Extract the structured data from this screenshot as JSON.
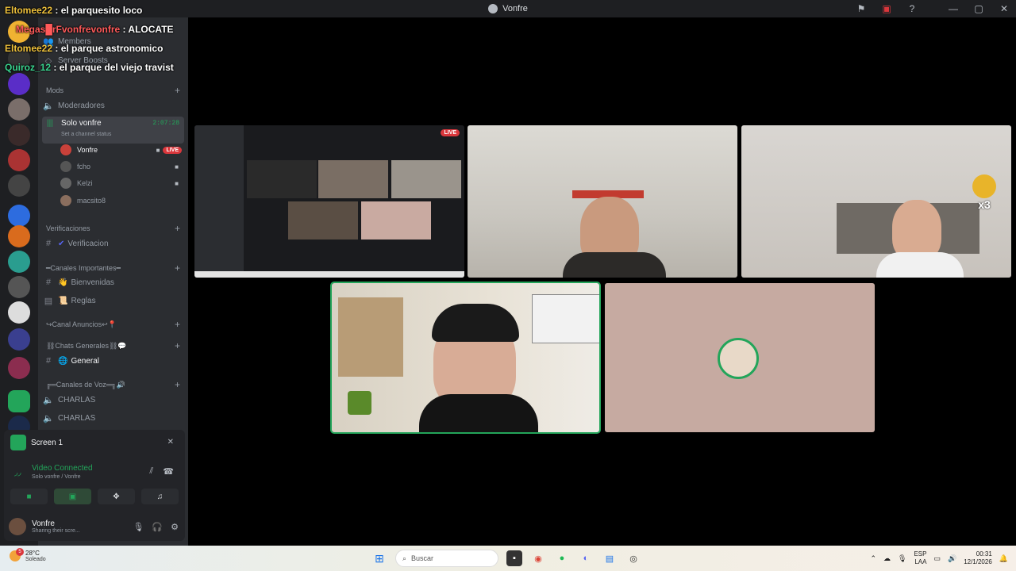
{
  "titlebar": {
    "title": "Vonfre",
    "icons": [
      "inbox-icon",
      "monitor-alert-icon",
      "help-icon"
    ],
    "window_controls": [
      "—",
      "▢",
      "✕"
    ]
  },
  "chat_overlay": [
    {
      "user": "Eltomee22",
      "sep": " : ",
      "msg": "el parquesito loco"
    },
    {
      "user": "Megas█rFvonfrevonfre",
      "sep": " : ",
      "msg": "ALOCATE"
    },
    {
      "user": "Eltomee22",
      "sep": " : ",
      "msg": "el parque astronomico"
    },
    {
      "user": "Quiroz_12",
      "sep": " : ",
      "msg": "el parque del viejo travist"
    }
  ],
  "sidebar": {
    "menu_items": [
      "Members",
      "Server Boosts"
    ],
    "categories": {
      "mods": "Mods",
      "verificaciones": "Verificaciones",
      "importantes": "━Canales Importantes━",
      "anuncios": "↪Canal Anuncios↩📍",
      "generales": "⛓Chats Generales⛓💬",
      "voz": "╔═Canales de Voz═╗🔊"
    },
    "channels": {
      "moderadores": "Moderadores",
      "solo_vonfre": "Solo vonfre",
      "solo_vonfre_time": "2:07:28",
      "solo_vonfre_status": "Set a channel status",
      "verificacion": "Verificacion",
      "bienvenidas": "Bienvenidas",
      "reglas": "Reglas",
      "general": "General",
      "charlas1": "CHARLAS",
      "charlas2": "CHARLAS"
    },
    "voice_users": [
      {
        "name": "Vonfre",
        "live": "LIVE"
      },
      {
        "name": "fcho"
      },
      {
        "name": "Kelzi"
      },
      {
        "name": "macsito8"
      }
    ]
  },
  "voice_panel": {
    "title": "Screen 1",
    "status": "Video Connected",
    "channel": "Solo vonfre / Vonfre",
    "user_name": "Vonfre",
    "user_status": "Sharing their scre..."
  },
  "stage": {
    "live_label": "LIVE",
    "reaction_count": "x3"
  },
  "taskbar": {
    "temp": "28°C",
    "weather": "Soleado",
    "weather_badge": "5",
    "search_placeholder": "Buscar",
    "lang1": "ESP",
    "lang2": "LAA",
    "time": "00:31",
    "date": "12/1/2026"
  },
  "colors": {
    "discord_green": "#23a55a",
    "live_red": "#da373c",
    "sidebar": "#2b2d31",
    "server_rail": "#1e1f22"
  }
}
